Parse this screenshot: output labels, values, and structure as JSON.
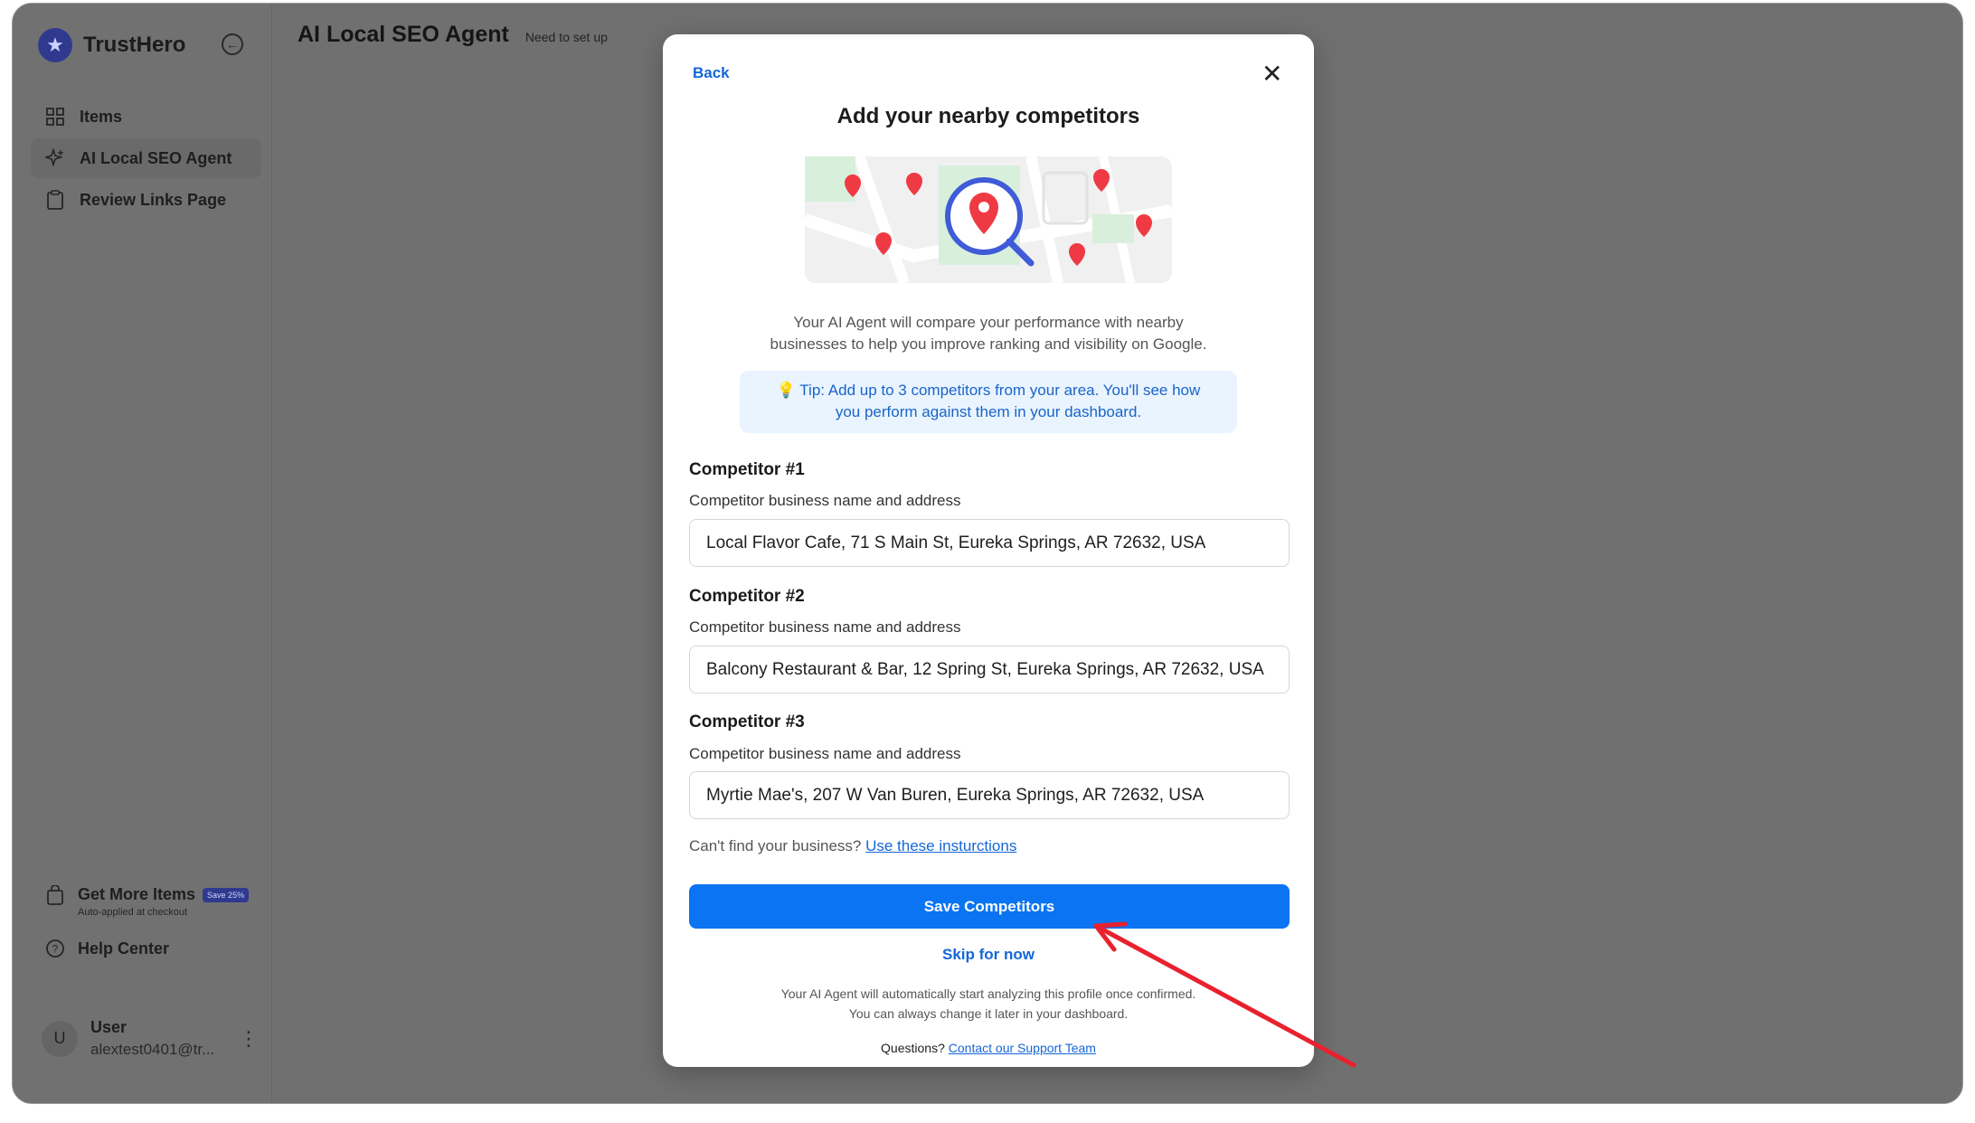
{
  "brand": {
    "name": "TrustHero",
    "logo_icon": "star-icon"
  },
  "sidebar": {
    "collapse_icon": "collapse-left-icon",
    "items": [
      {
        "label": "Items",
        "icon": "grid-icon",
        "active": false
      },
      {
        "label": "AI Local SEO Agent",
        "icon": "sparkles-icon",
        "active": true
      },
      {
        "label": "Review Links Page",
        "icon": "clipboard-icon",
        "active": false
      }
    ],
    "promo": {
      "title": "Get More Items",
      "badge": "Save 25%",
      "subtitle": "Auto-applied at checkout"
    },
    "help": {
      "label": "Help Center"
    },
    "user": {
      "initial": "U",
      "name": "User",
      "email": "alextest0401@tr..."
    }
  },
  "header": {
    "title": "AI Local SEO Agent",
    "status": "Need to set up"
  },
  "modal": {
    "back_label": "Back",
    "title": "Add your nearby competitors",
    "intro_line1": "Your AI Agent will compare your performance with nearby",
    "intro_line2": "businesses to help you improve ranking and visibility on Google.",
    "tip_line1": "💡 Tip: Add up to 3 competitors from your area. You'll see how",
    "tip_line2": "you perform against them in your dashboard.",
    "competitors": [
      {
        "heading": "Competitor #1",
        "label": "Competitor business name and address",
        "value": "Local Flavor Cafe, 71 S Main St, Eureka Springs, AR 72632, USA"
      },
      {
        "heading": "Competitor #2",
        "label": "Competitor business name and address",
        "value": "Balcony Restaurant & Bar, 12 Spring St, Eureka Springs, AR 72632, USA"
      },
      {
        "heading": "Competitor #3",
        "label": "Competitor business name and address",
        "value": "Myrtie Mae's, 207 W Van Buren, Eureka Springs, AR 72632, USA"
      }
    ],
    "cant_find_text": "Can't find your business?",
    "cant_find_link": "Use these insturctions",
    "save_label": "Save Competitors",
    "skip_label": "Skip for now",
    "footer_line1": "Your AI Agent will automatically start analyzing this profile once confirmed.",
    "footer_line2": "You can always change it later in your dashboard.",
    "questions_text": "Questions?",
    "questions_link": "Contact our Support Team"
  },
  "colors": {
    "accent": "#0a74f2",
    "link": "#1466d8",
    "annotation_arrow": "#e8212e"
  }
}
